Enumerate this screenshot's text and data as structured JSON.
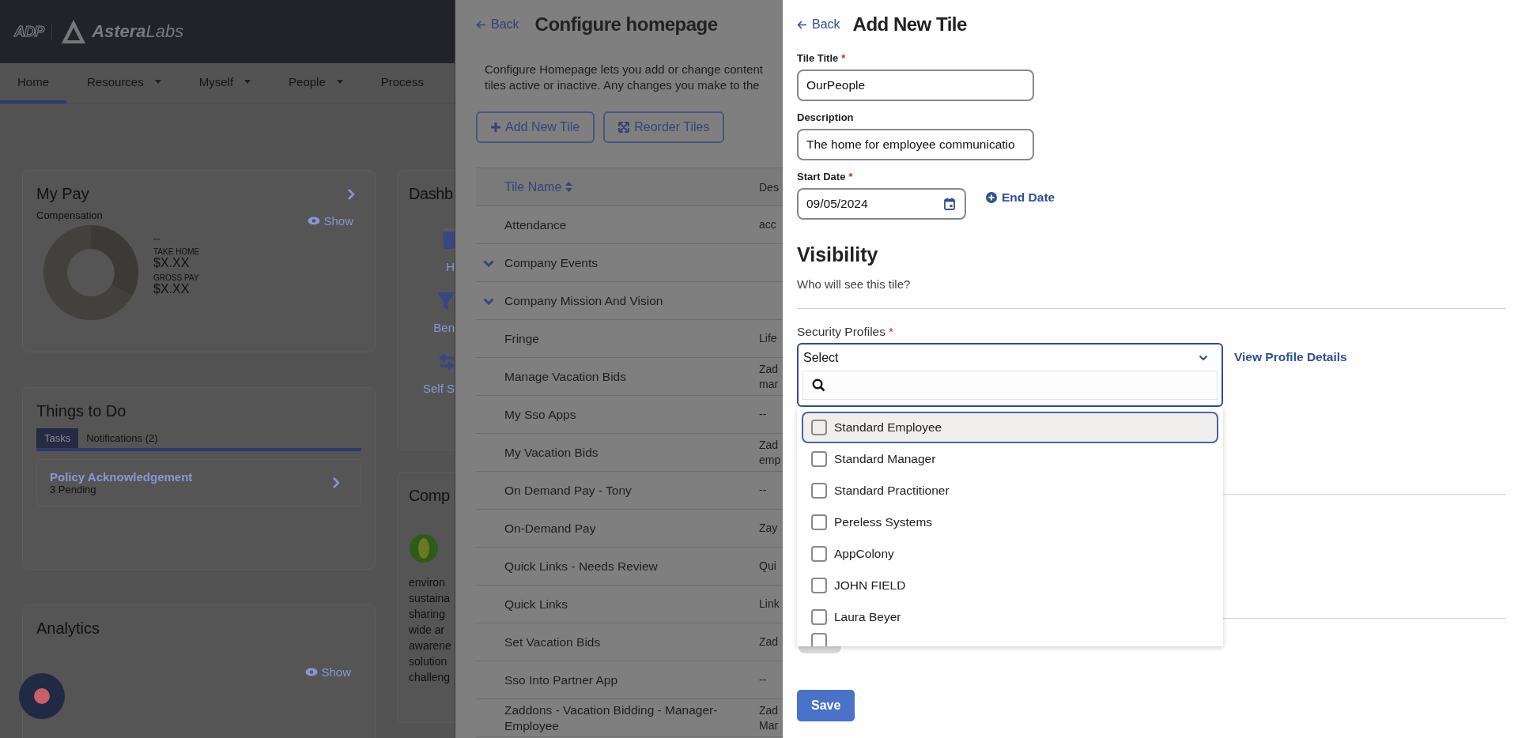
{
  "header": {
    "brand": "ADP",
    "company": "**Astera**Labs"
  },
  "nav": [
    {
      "label": "Home",
      "selected": true,
      "has_menu": false
    },
    {
      "label": "Resources",
      "selected": false,
      "has_menu": true
    },
    {
      "label": "Myself",
      "selected": false,
      "has_menu": true
    },
    {
      "label": "People",
      "selected": false,
      "has_menu": true
    },
    {
      "label": "Process",
      "selected": false,
      "has_menu": false
    }
  ],
  "my_pay": {
    "title": "My Pay",
    "subtitle": "Compensation",
    "show": "Show",
    "amount": "--",
    "take_home_label": "TAKE HOME",
    "take_home": "$X.XX",
    "gross_label": "GROSS PAY",
    "gross": "$X.XX"
  },
  "things_to_do": {
    "title": "Things to Do",
    "tabs": [
      {
        "label": "Tasks",
        "selected": true
      },
      {
        "label": "Notifications (2)",
        "selected": false
      }
    ],
    "task": {
      "title": "Policy Acknowledgement",
      "subtitle": "3 Pending"
    }
  },
  "analytics": {
    "title": "Analytics",
    "show": "Show"
  },
  "dashboard": {
    "title": "Dashb",
    "items": [
      {
        "label": "H",
        "kind": "home"
      },
      {
        "label": "Ben",
        "kind": "benefits"
      },
      {
        "label": "Self S",
        "kind": "self"
      }
    ]
  },
  "company": {
    "title": "Comp",
    "lines": [
      "environ",
      "sustaina",
      "sharing",
      "wide ar",
      "awarene",
      "solution",
      "challeng"
    ]
  },
  "configure": {
    "back": "Back",
    "title": "Configure homepage",
    "description": [
      "Configure Homepage lets you add or change content",
      "tiles active or inactive. Any changes you make to the"
    ],
    "buttons": [
      {
        "label": "Add New Tile",
        "kind": "add"
      },
      {
        "label": "Reorder Tiles",
        "kind": "reorder"
      }
    ],
    "columns": [
      "Tile Name",
      "Des"
    ],
    "rows": [
      {
        "name": "Attendance",
        "expandable": false,
        "description": [
          "acc"
        ]
      },
      {
        "name": "Company Events",
        "expandable": true,
        "description": []
      },
      {
        "name": "Company Mission And Vision",
        "expandable": true,
        "description": []
      },
      {
        "name": "Fringe",
        "expandable": false,
        "description": [
          "Life"
        ]
      },
      {
        "name": "Manage Vacation Bids",
        "expandable": false,
        "description": [
          "Zad",
          "mar"
        ]
      },
      {
        "name": "My Sso Apps",
        "expandable": false,
        "description": [
          "--"
        ]
      },
      {
        "name": "My Vacation Bids",
        "expandable": false,
        "description": [
          "Zad",
          "emp"
        ]
      },
      {
        "name": "On Demand Pay - Tony",
        "expandable": false,
        "description": [
          "--"
        ]
      },
      {
        "name": "On-Demand Pay",
        "expandable": false,
        "description": [
          "Zay"
        ]
      },
      {
        "name": "Quick Links - Needs Review",
        "expandable": false,
        "description": [
          "Qui"
        ]
      },
      {
        "name": "Quick Links",
        "expandable": false,
        "description": [
          "Link"
        ]
      },
      {
        "name": "Set Vacation Bids",
        "expandable": false,
        "description": [
          "Zad"
        ]
      },
      {
        "name": "Sso Into Partner App",
        "expandable": false,
        "description": [
          "--"
        ]
      },
      {
        "name": "Zaddons - Vacation Bidding - Manager-Employee",
        "expandable": false,
        "description": [
          "Zad",
          "Mar"
        ]
      }
    ]
  },
  "add_tile": {
    "back": "Back",
    "title": "Add New Tile",
    "fields": [
      {
        "label": "Tile Title",
        "required_mark": "*",
        "value": "OurPeople",
        "kind": "text"
      },
      {
        "label": "Description",
        "value": "The home for employee communicatio",
        "kind": "text"
      },
      {
        "label": "Start Date",
        "required_mark": "*",
        "value": "09/05/2024",
        "kind": "date"
      }
    ],
    "end_date": "End Date",
    "visibility_title": "Visibility",
    "visibility_subtitle": "Who will see this tile?",
    "security_label": "Security Profiles",
    "security_required_mark": "*",
    "security_value": "Select",
    "view_profile": "View Profile Details",
    "options": [
      {
        "label": "Standard Employee",
        "checked": false,
        "focused": true
      },
      {
        "label": "Standard Manager",
        "checked": false,
        "focused": false
      },
      {
        "label": "Standard Practitioner",
        "checked": false,
        "focused": false
      },
      {
        "label": "Pereless Systems",
        "checked": false,
        "focused": false
      },
      {
        "label": "AppColony",
        "checked": false,
        "focused": false
      },
      {
        "label": "JOHN FIELD",
        "checked": false,
        "focused": false
      },
      {
        "label": "Laura Beyer",
        "checked": false,
        "focused": false
      }
    ],
    "partial_option": {
      "checked": false
    },
    "partial_toggle": {
      "on": false
    },
    "save": "Save"
  }
}
